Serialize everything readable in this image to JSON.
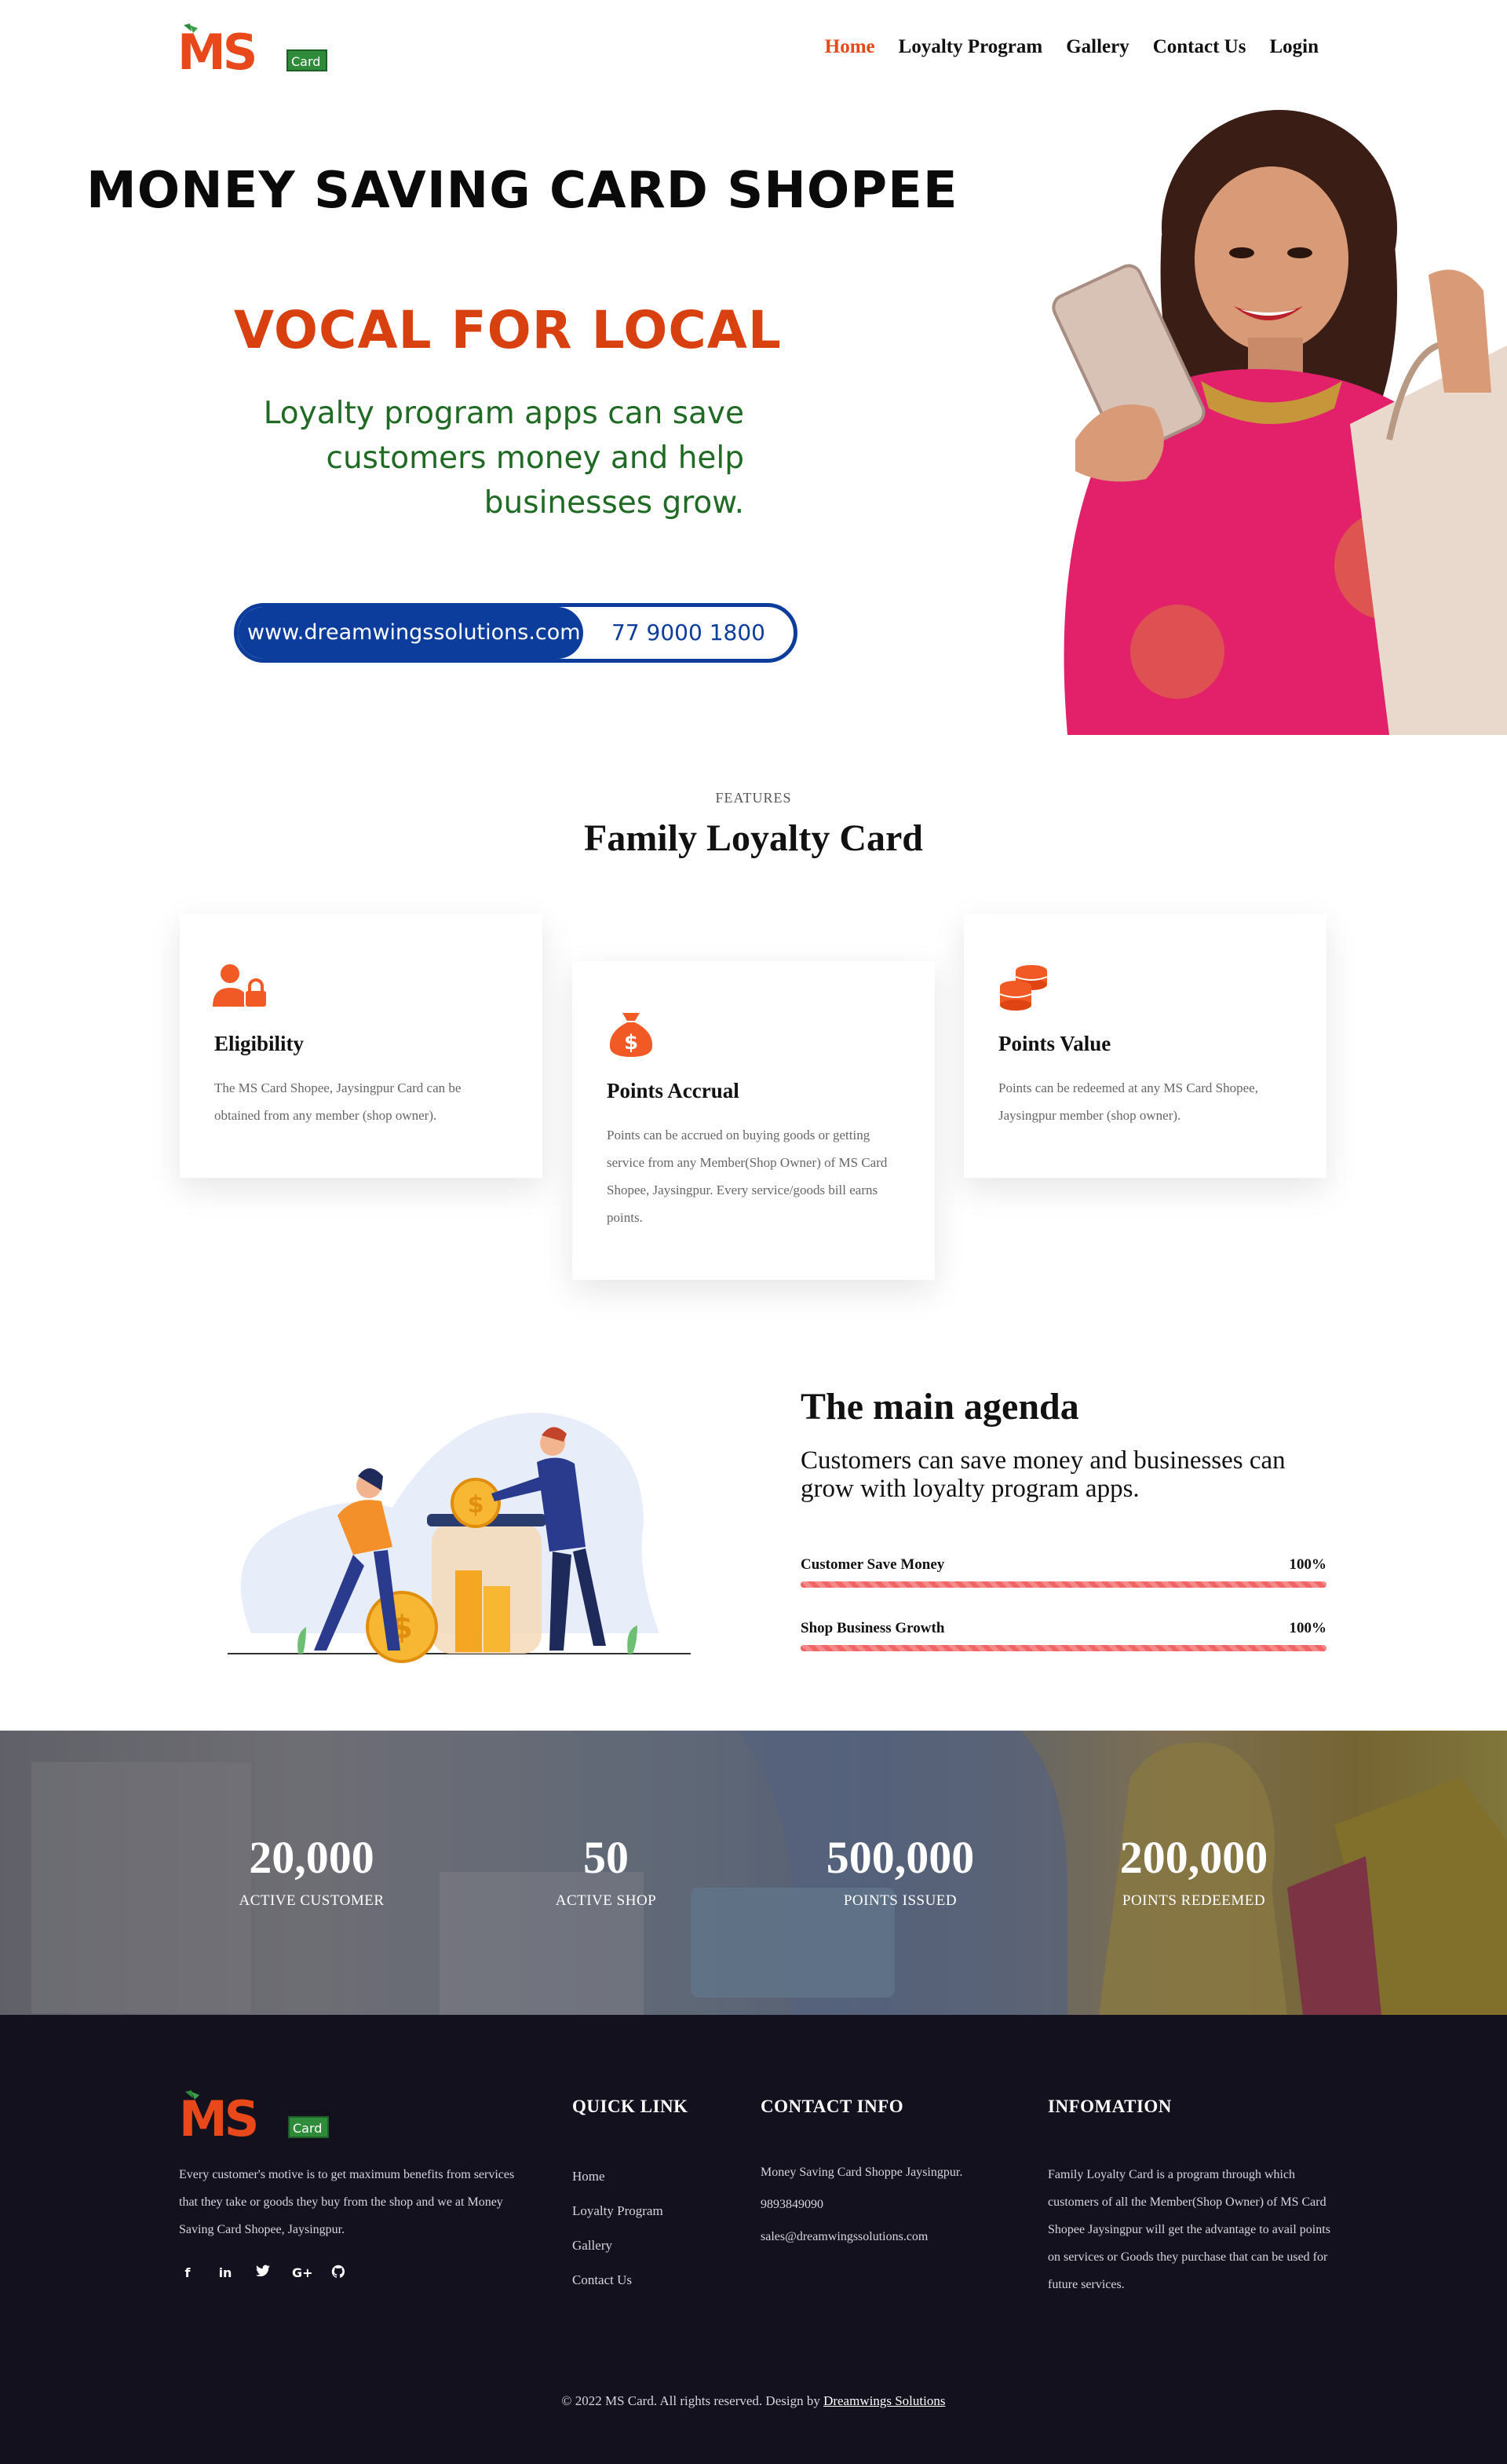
{
  "nav": {
    "logo_text": "MS",
    "logo_badge": "Card",
    "items": [
      {
        "label": "Home",
        "active": true
      },
      {
        "label": "Loyalty Program"
      },
      {
        "label": "Gallery"
      },
      {
        "label": "Contact Us"
      },
      {
        "label": "Login"
      }
    ]
  },
  "hero": {
    "title": "MONEY SAVING CARD SHOPEE",
    "slogan": "VOCAL FOR LOCAL",
    "subtitle_lines": [
      "Loyalty program apps can save",
      "customers money and help",
      "businesses grow."
    ],
    "website": "www.dreamwingssolutions.com",
    "phone": "77 9000 1800"
  },
  "features": {
    "eyebrow": "FEATURES",
    "title_pre": "Family ",
    "title_bold": "Loyalty",
    "title_post": " Card",
    "cards": [
      {
        "icon": "user-lock-icon",
        "title": "Eligibility",
        "text": "The MS Card Shopee, Jaysingpur Card can be obtained from any member (shop owner)."
      },
      {
        "icon": "money-bag-icon",
        "title": "Points Accrual",
        "text": "Points can be accrued on buying goods or getting service from any Member(Shop Owner) of MS Card Shopee, Jaysingpur. Every service/goods bill earns points."
      },
      {
        "icon": "coins-icon",
        "title": "Points Value",
        "text": "Points can be redeemed at any MS Card Shopee, Jaysingpur member (shop owner)."
      }
    ]
  },
  "agenda": {
    "title": "The main agenda",
    "text": "Customers can save money and businesses can grow with loyalty program apps.",
    "bars": [
      {
        "label": "Customer Save Money",
        "value_text": "100%",
        "percent": 100
      },
      {
        "label": "Shop Business Growth",
        "value_text": "100%",
        "percent": 100
      }
    ]
  },
  "stats": [
    {
      "number": "20,000",
      "label": "ACTIVE CUSTOMER"
    },
    {
      "number": "50",
      "label": "ACTIVE SHOP"
    },
    {
      "number": "500,000",
      "label": "POINTS ISSUED"
    },
    {
      "number": "200,000",
      "label": "POINTS REDEEMED"
    }
  ],
  "footer": {
    "about": "Every customer's motive is to get maximum benefits from services that they take or goods they buy from the shop and we at Money Saving Card Shopee, Jaysingpur.",
    "socials": [
      "facebook-icon",
      "linkedin-icon",
      "twitter-icon",
      "google-plus-icon",
      "github-icon"
    ],
    "quick_title": "QUICK LINK",
    "quick_links": [
      "Home",
      "Loyalty Program",
      "Gallery",
      "Contact Us"
    ],
    "contact_title": "CONTACT INFO",
    "contact_address": "Money Saving Card Shoppe Jaysingpur.",
    "contact_phone": "9893849090",
    "contact_email": "sales@dreamwingssolutions.com",
    "info_title": "INFOMATION",
    "info_text": "Family Loyalty Card is a program through which customers of all the Member(Shop Owner) of MS Card Shopee Jaysingpur will get the advantage to avail points on services or Goods they purchase that can be used for future services.",
    "copyright": "© 2022 MS Card. All rights reserved. Design by",
    "designer": "Dreamwings Solutions"
  },
  "colors": {
    "accent": "#e8481a",
    "brand_green": "#1f6b24",
    "brand_blue": "#0c3d9c",
    "footer_bg": "#13111d"
  }
}
